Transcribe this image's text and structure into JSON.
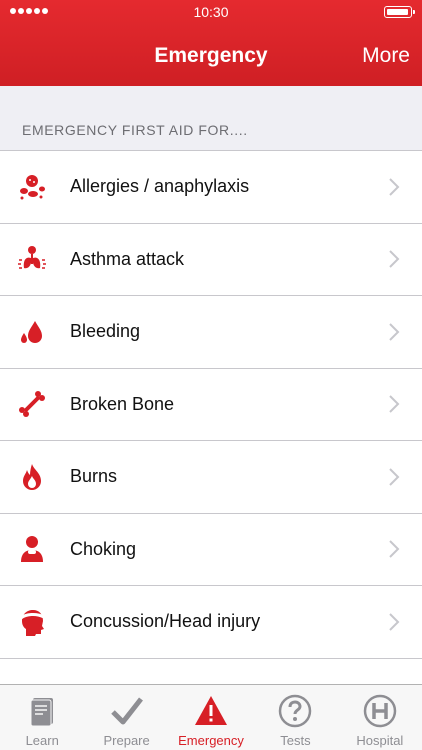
{
  "status_bar": {
    "time": "10:30"
  },
  "nav": {
    "title": "Emergency",
    "more_label": "More"
  },
  "section": {
    "header": "EMERGENCY FIRST AID FOR...."
  },
  "list": {
    "items": [
      {
        "label": "Allergies / anaphylaxis",
        "icon": "allergy-icon"
      },
      {
        "label": "Asthma attack",
        "icon": "lungs-icon"
      },
      {
        "label": "Bleeding",
        "icon": "blood-drop-icon"
      },
      {
        "label": "Broken Bone",
        "icon": "bone-icon"
      },
      {
        "label": "Burns",
        "icon": "flame-icon"
      },
      {
        "label": "Choking",
        "icon": "choking-person-icon"
      },
      {
        "label": "Concussion/Head injury",
        "icon": "head-injury-icon"
      },
      {
        "label": "",
        "icon": "partial-icon"
      }
    ]
  },
  "tabbar": {
    "tabs": [
      {
        "label": "Learn",
        "icon": "book-icon"
      },
      {
        "label": "Prepare",
        "icon": "checkmark-icon"
      },
      {
        "label": "Emergency",
        "icon": "warning-icon",
        "active": true
      },
      {
        "label": "Tests",
        "icon": "question-icon"
      },
      {
        "label": "Hospital",
        "icon": "hospital-icon"
      }
    ]
  },
  "colors": {
    "brand_red": "#d71f26",
    "tab_inactive": "#8e8e93",
    "chevron": "#c7c7cc"
  }
}
